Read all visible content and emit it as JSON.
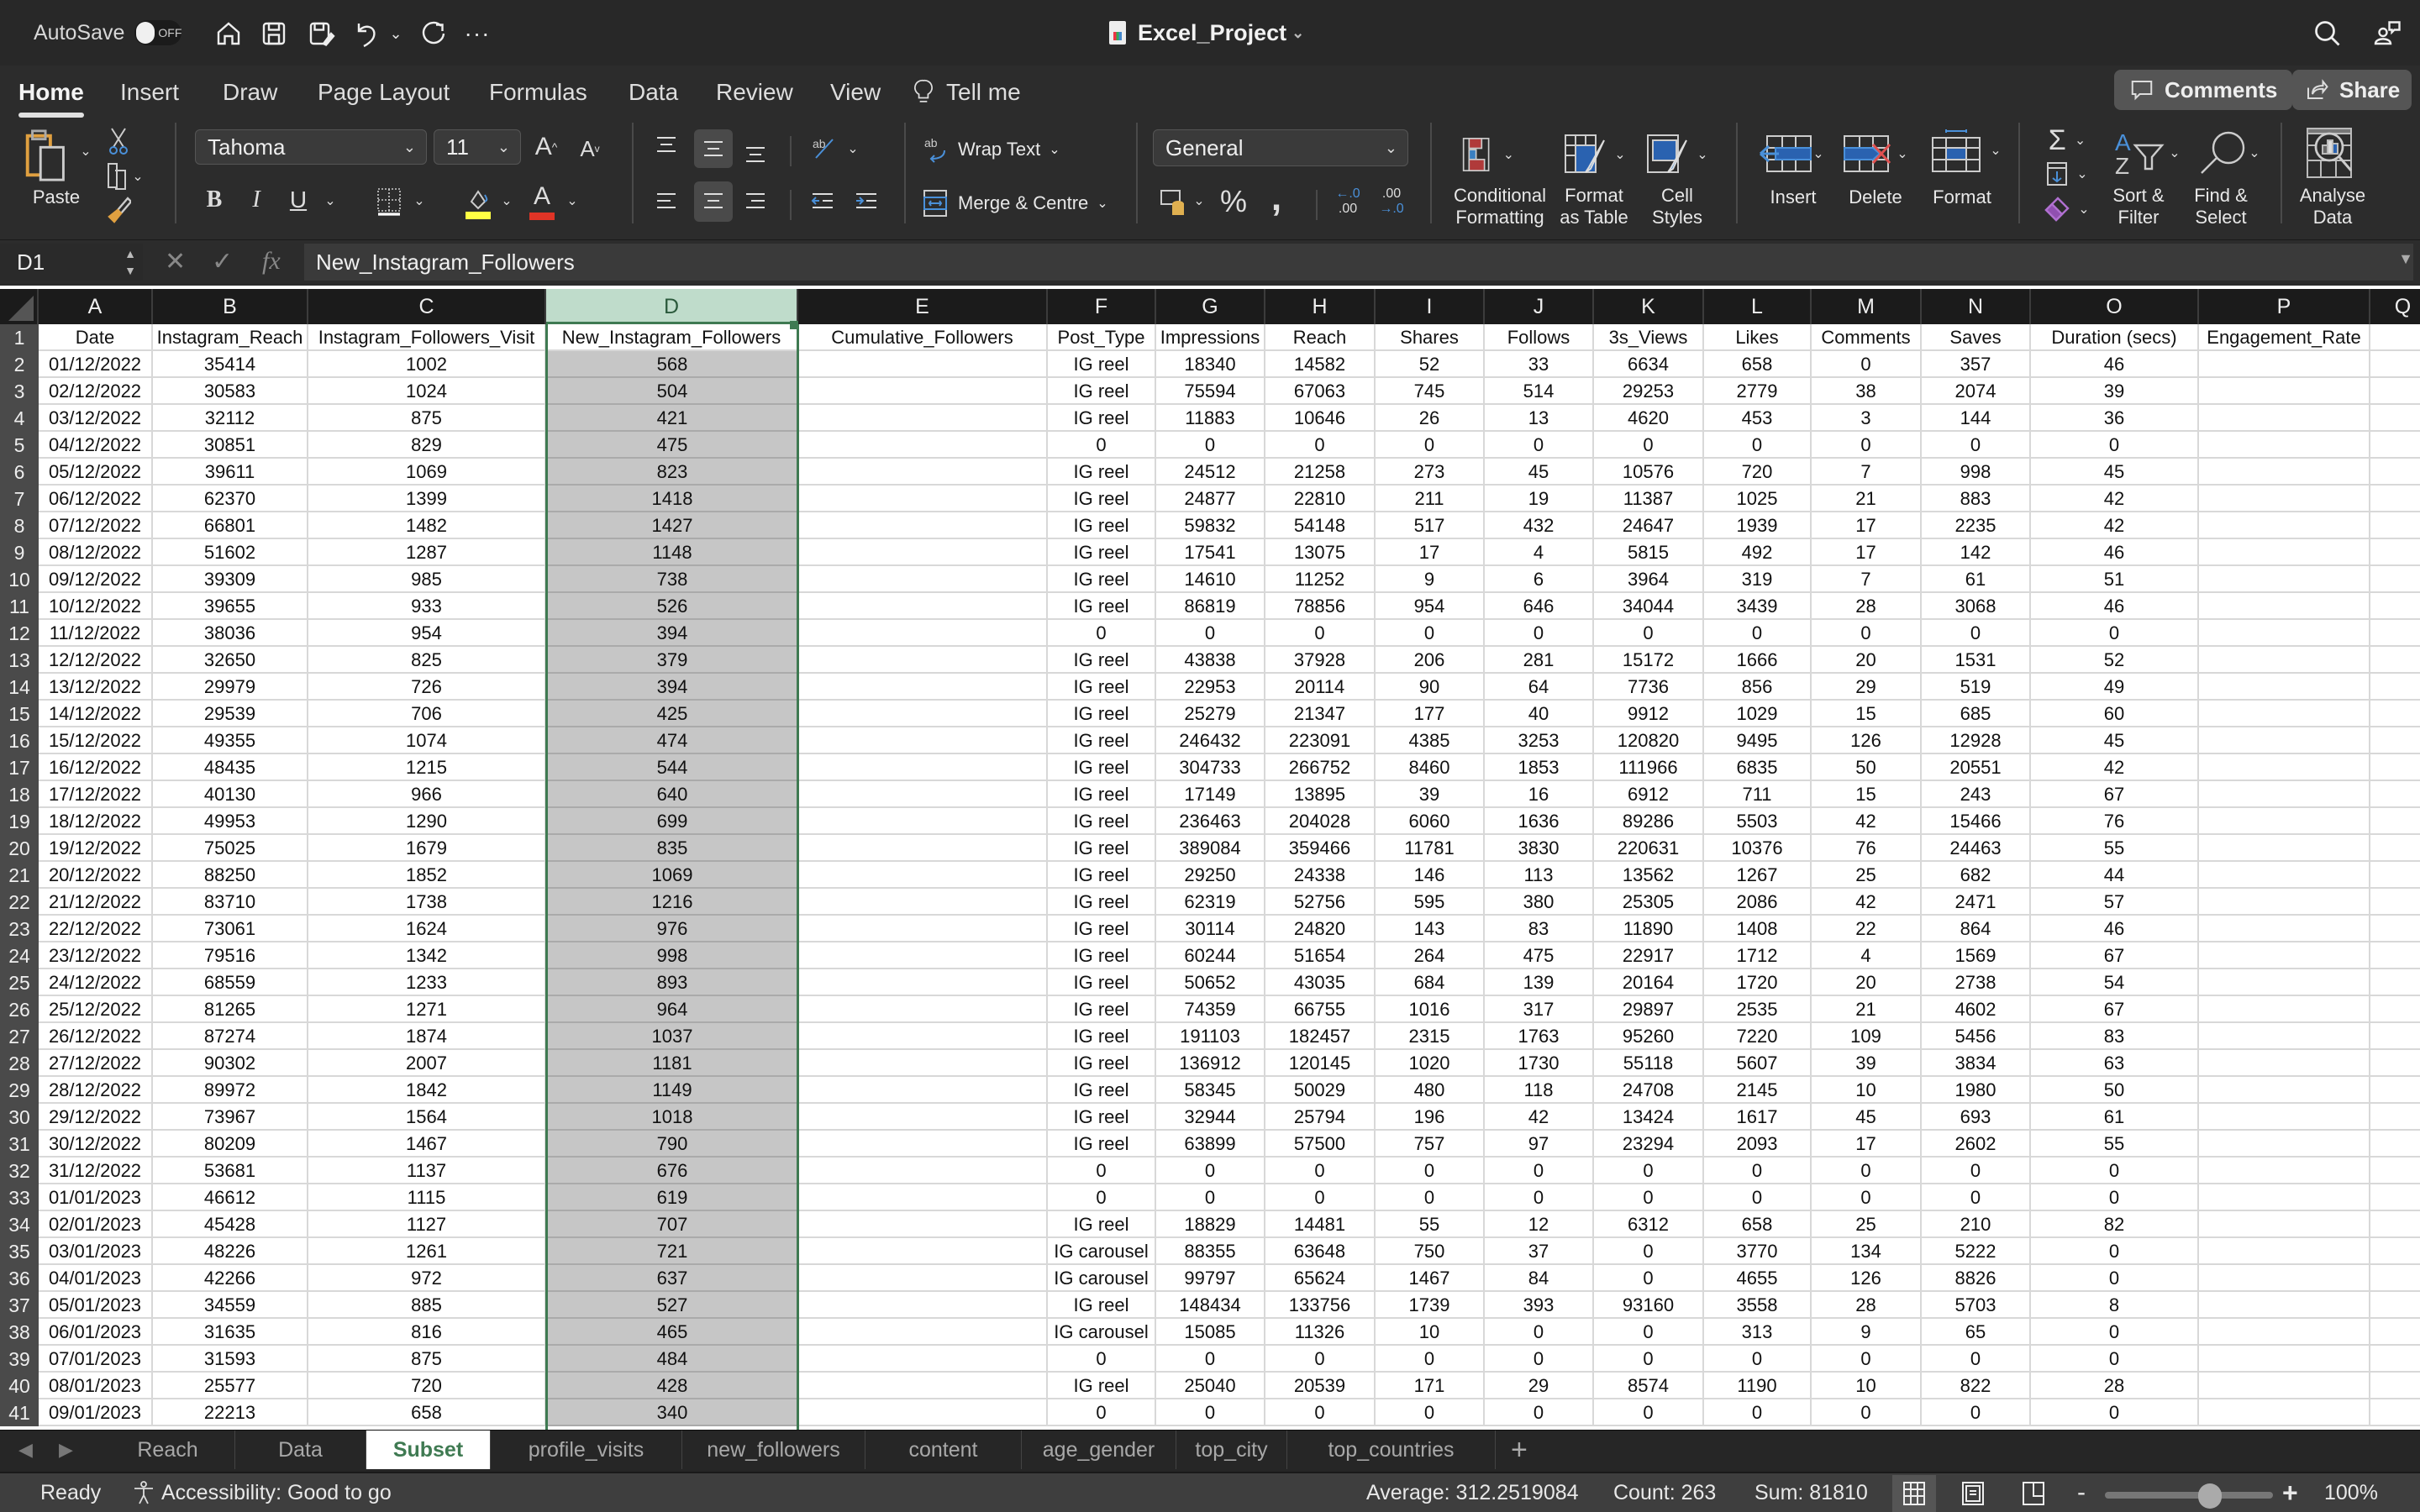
{
  "titlebar": {
    "autosave_label": "AutoSave",
    "autosave_state": "OFF",
    "doc_title": "Excel_Project",
    "quick_access": [
      "home-icon",
      "save-icon",
      "save-as-icon",
      "undo-icon",
      "undo-dropdown-icon",
      "redo-icon",
      "more-icon"
    ]
  },
  "ribbon_tabs": [
    {
      "label": "Home",
      "active": true
    },
    {
      "label": "Insert"
    },
    {
      "label": "Draw"
    },
    {
      "label": "Page Layout"
    },
    {
      "label": "Formulas"
    },
    {
      "label": "Data"
    },
    {
      "label": "Review"
    },
    {
      "label": "View"
    },
    {
      "label": "Tell me"
    }
  ],
  "header_buttons": {
    "comments": "Comments",
    "share": "Share"
  },
  "ribbon": {
    "paste_label": "Paste",
    "font_name": "Tahoma",
    "font_size": "11",
    "wrap_text": "Wrap Text",
    "merge_centre": "Merge & Centre",
    "number_format": "General",
    "conditional_formatting": [
      "Conditional",
      "Formatting"
    ],
    "format_as_table": [
      "Format",
      "as Table"
    ],
    "cell_styles": [
      "Cell",
      "Styles"
    ],
    "insert": "Insert",
    "delete": "Delete",
    "format": "Format",
    "sort_filter": [
      "Sort &",
      "Filter"
    ],
    "find_select": [
      "Find &",
      "Select"
    ],
    "analyse_data": [
      "Analyse",
      "Data"
    ],
    "fill_color": "#ffff44",
    "font_color": "#e03426"
  },
  "formula_bar": {
    "name_box": "D1",
    "formula": "New_Instagram_Followers"
  },
  "columns": [
    "A",
    "B",
    "C",
    "D",
    "E",
    "F",
    "G",
    "H",
    "I",
    "J",
    "K",
    "L",
    "M",
    "N",
    "O",
    "P",
    "Q"
  ],
  "selected_column": "D",
  "headers": [
    "Date",
    "Instagram_Reach",
    "Instagram_Followers_Visit",
    "New_Instagram_Followers",
    "Cumulative_Followers",
    "Post_Type",
    "Impressions",
    "Reach",
    "Shares",
    "Follows",
    "3s_Views",
    "Likes",
    "Comments",
    "Saves",
    "Duration (secs)",
    "Engagement_Rate"
  ],
  "rows": [
    [
      "01/12/2022",
      "35414",
      "1002",
      "568",
      "",
      "IG reel",
      "18340",
      "14582",
      "52",
      "33",
      "6634",
      "658",
      "0",
      "357",
      "46",
      ""
    ],
    [
      "02/12/2022",
      "30583",
      "1024",
      "504",
      "",
      "IG reel",
      "75594",
      "67063",
      "745",
      "514",
      "29253",
      "2779",
      "38",
      "2074",
      "39",
      ""
    ],
    [
      "03/12/2022",
      "32112",
      "875",
      "421",
      "",
      "IG reel",
      "11883",
      "10646",
      "26",
      "13",
      "4620",
      "453",
      "3",
      "144",
      "36",
      ""
    ],
    [
      "04/12/2022",
      "30851",
      "829",
      "475",
      "",
      "0",
      "0",
      "0",
      "0",
      "0",
      "0",
      "0",
      "0",
      "0",
      "0",
      ""
    ],
    [
      "05/12/2022",
      "39611",
      "1069",
      "823",
      "",
      "IG reel",
      "24512",
      "21258",
      "273",
      "45",
      "10576",
      "720",
      "7",
      "998",
      "45",
      ""
    ],
    [
      "06/12/2022",
      "62370",
      "1399",
      "1418",
      "",
      "IG reel",
      "24877",
      "22810",
      "211",
      "19",
      "11387",
      "1025",
      "21",
      "883",
      "42",
      ""
    ],
    [
      "07/12/2022",
      "66801",
      "1482",
      "1427",
      "",
      "IG reel",
      "59832",
      "54148",
      "517",
      "432",
      "24647",
      "1939",
      "17",
      "2235",
      "42",
      ""
    ],
    [
      "08/12/2022",
      "51602",
      "1287",
      "1148",
      "",
      "IG reel",
      "17541",
      "13075",
      "17",
      "4",
      "5815",
      "492",
      "17",
      "142",
      "46",
      ""
    ],
    [
      "09/12/2022",
      "39309",
      "985",
      "738",
      "",
      "IG reel",
      "14610",
      "11252",
      "9",
      "6",
      "3964",
      "319",
      "7",
      "61",
      "51",
      ""
    ],
    [
      "10/12/2022",
      "39655",
      "933",
      "526",
      "",
      "IG reel",
      "86819",
      "78856",
      "954",
      "646",
      "34044",
      "3439",
      "28",
      "3068",
      "46",
      ""
    ],
    [
      "11/12/2022",
      "38036",
      "954",
      "394",
      "",
      "0",
      "0",
      "0",
      "0",
      "0",
      "0",
      "0",
      "0",
      "0",
      "0",
      ""
    ],
    [
      "12/12/2022",
      "32650",
      "825",
      "379",
      "",
      "IG reel",
      "43838",
      "37928",
      "206",
      "281",
      "15172",
      "1666",
      "20",
      "1531",
      "52",
      ""
    ],
    [
      "13/12/2022",
      "29979",
      "726",
      "394",
      "",
      "IG reel",
      "22953",
      "20114",
      "90",
      "64",
      "7736",
      "856",
      "29",
      "519",
      "49",
      ""
    ],
    [
      "14/12/2022",
      "29539",
      "706",
      "425",
      "",
      "IG reel",
      "25279",
      "21347",
      "177",
      "40",
      "9912",
      "1029",
      "15",
      "685",
      "60",
      ""
    ],
    [
      "15/12/2022",
      "49355",
      "1074",
      "474",
      "",
      "IG reel",
      "246432",
      "223091",
      "4385",
      "3253",
      "120820",
      "9495",
      "126",
      "12928",
      "45",
      ""
    ],
    [
      "16/12/2022",
      "48435",
      "1215",
      "544",
      "",
      "IG reel",
      "304733",
      "266752",
      "8460",
      "1853",
      "111966",
      "6835",
      "50",
      "20551",
      "42",
      ""
    ],
    [
      "17/12/2022",
      "40130",
      "966",
      "640",
      "",
      "IG reel",
      "17149",
      "13895",
      "39",
      "16",
      "6912",
      "711",
      "15",
      "243",
      "67",
      ""
    ],
    [
      "18/12/2022",
      "49953",
      "1290",
      "699",
      "",
      "IG reel",
      "236463",
      "204028",
      "6060",
      "1636",
      "89286",
      "5503",
      "42",
      "15466",
      "76",
      ""
    ],
    [
      "19/12/2022",
      "75025",
      "1679",
      "835",
      "",
      "IG reel",
      "389084",
      "359466",
      "11781",
      "3830",
      "220631",
      "10376",
      "76",
      "24463",
      "55",
      ""
    ],
    [
      "20/12/2022",
      "88250",
      "1852",
      "1069",
      "",
      "IG reel",
      "29250",
      "24338",
      "146",
      "113",
      "13562",
      "1267",
      "25",
      "682",
      "44",
      ""
    ],
    [
      "21/12/2022",
      "83710",
      "1738",
      "1216",
      "",
      "IG reel",
      "62319",
      "52756",
      "595",
      "380",
      "25305",
      "2086",
      "42",
      "2471",
      "57",
      ""
    ],
    [
      "22/12/2022",
      "73061",
      "1624",
      "976",
      "",
      "IG reel",
      "30114",
      "24820",
      "143",
      "83",
      "11890",
      "1408",
      "22",
      "864",
      "46",
      ""
    ],
    [
      "23/12/2022",
      "79516",
      "1342",
      "998",
      "",
      "IG reel",
      "60244",
      "51654",
      "264",
      "475",
      "22917",
      "1712",
      "4",
      "1569",
      "67",
      ""
    ],
    [
      "24/12/2022",
      "68559",
      "1233",
      "893",
      "",
      "IG reel",
      "50652",
      "43035",
      "684",
      "139",
      "20164",
      "1720",
      "20",
      "2738",
      "54",
      ""
    ],
    [
      "25/12/2022",
      "81265",
      "1271",
      "964",
      "",
      "IG reel",
      "74359",
      "66755",
      "1016",
      "317",
      "29897",
      "2535",
      "21",
      "4602",
      "67",
      ""
    ],
    [
      "26/12/2022",
      "87274",
      "1874",
      "1037",
      "",
      "IG reel",
      "191103",
      "182457",
      "2315",
      "1763",
      "95260",
      "7220",
      "109",
      "5456",
      "83",
      ""
    ],
    [
      "27/12/2022",
      "90302",
      "2007",
      "1181",
      "",
      "IG reel",
      "136912",
      "120145",
      "1020",
      "1730",
      "55118",
      "5607",
      "39",
      "3834",
      "63",
      ""
    ],
    [
      "28/12/2022",
      "89972",
      "1842",
      "1149",
      "",
      "IG reel",
      "58345",
      "50029",
      "480",
      "118",
      "24708",
      "2145",
      "10",
      "1980",
      "50",
      ""
    ],
    [
      "29/12/2022",
      "73967",
      "1564",
      "1018",
      "",
      "IG reel",
      "32944",
      "25794",
      "196",
      "42",
      "13424",
      "1617",
      "45",
      "693",
      "61",
      ""
    ],
    [
      "30/12/2022",
      "80209",
      "1467",
      "790",
      "",
      "IG reel",
      "63899",
      "57500",
      "757",
      "97",
      "23294",
      "2093",
      "17",
      "2602",
      "55",
      ""
    ],
    [
      "31/12/2022",
      "53681",
      "1137",
      "676",
      "",
      "0",
      "0",
      "0",
      "0",
      "0",
      "0",
      "0",
      "0",
      "0",
      "0",
      ""
    ],
    [
      "01/01/2023",
      "46612",
      "1115",
      "619",
      "",
      "0",
      "0",
      "0",
      "0",
      "0",
      "0",
      "0",
      "0",
      "0",
      "0",
      ""
    ],
    [
      "02/01/2023",
      "45428",
      "1127",
      "707",
      "",
      "IG reel",
      "18829",
      "14481",
      "55",
      "12",
      "6312",
      "658",
      "25",
      "210",
      "82",
      ""
    ],
    [
      "03/01/2023",
      "48226",
      "1261",
      "721",
      "",
      "IG carousel",
      "88355",
      "63648",
      "750",
      "37",
      "0",
      "3770",
      "134",
      "5222",
      "0",
      ""
    ],
    [
      "04/01/2023",
      "42266",
      "972",
      "637",
      "",
      "IG carousel",
      "99797",
      "65624",
      "1467",
      "84",
      "0",
      "4655",
      "126",
      "8826",
      "0",
      ""
    ],
    [
      "05/01/2023",
      "34559",
      "885",
      "527",
      "",
      "IG reel",
      "148434",
      "133756",
      "1739",
      "393",
      "93160",
      "3558",
      "28",
      "5703",
      "8",
      ""
    ],
    [
      "06/01/2023",
      "31635",
      "816",
      "465",
      "",
      "IG carousel",
      "15085",
      "11326",
      "10",
      "0",
      "0",
      "313",
      "9",
      "65",
      "0",
      ""
    ],
    [
      "07/01/2023",
      "31593",
      "875",
      "484",
      "",
      "0",
      "0",
      "0",
      "0",
      "0",
      "0",
      "0",
      "0",
      "0",
      "0",
      ""
    ],
    [
      "08/01/2023",
      "25577",
      "720",
      "428",
      "",
      "IG reel",
      "25040",
      "20539",
      "171",
      "29",
      "8574",
      "1190",
      "10",
      "822",
      "28",
      ""
    ],
    [
      "09/01/2023",
      "22213",
      "658",
      "340",
      "",
      "0",
      "0",
      "0",
      "0",
      "0",
      "0",
      "0",
      "0",
      "0",
      "0",
      ""
    ]
  ],
  "sheet_tabs": [
    {
      "label": "Reach"
    },
    {
      "label": "Data"
    },
    {
      "label": "Subset",
      "active": true
    },
    {
      "label": "profile_visits"
    },
    {
      "label": "new_followers"
    },
    {
      "label": "content"
    },
    {
      "label": "age_gender"
    },
    {
      "label": "top_city"
    },
    {
      "label": "top_countries"
    }
  ],
  "status": {
    "ready": "Ready",
    "accessibility": "Accessibility: Good to go",
    "average": "Average: 312.2519084",
    "count": "Count: 263",
    "sum": "Sum: 81810",
    "zoom": "100%",
    "zoom_level_percent": 100
  }
}
